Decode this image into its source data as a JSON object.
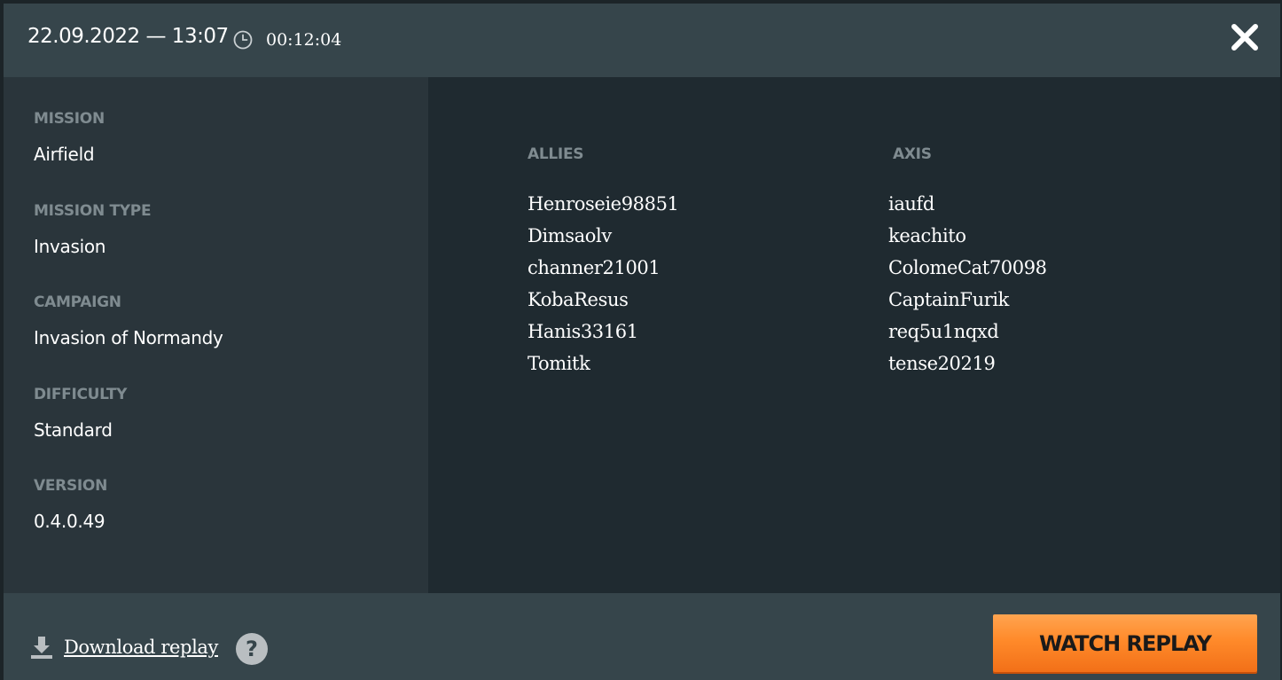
{
  "header": {
    "datetime": "22.09.2022 — 13:07",
    "duration_icon": "clock-icon",
    "duration": "00:12:04",
    "close_icon": "close-icon"
  },
  "info": {
    "mission_label": "MISSION",
    "mission_value": "Airfield",
    "mission_type_label": "MISSION TYPE",
    "mission_type_value": "Invasion",
    "campaign_label": "CAMPAIGN",
    "campaign_value": "Invasion of Normandy",
    "difficulty_label": "DIFFICULTY",
    "difficulty_value": "Standard",
    "version_label": "VERSION",
    "version_value": "0.4.0.49"
  },
  "teams": {
    "allies": {
      "title": "ALLIES",
      "players": [
        "Henroseie98851",
        "Dimsaolv",
        "channer21001",
        "KobaResus",
        "Hanis33161",
        "Tomitk"
      ]
    },
    "axis": {
      "title": "AXIS",
      "players": [
        "iaufd",
        "keachito",
        "ColomeCat70098",
        "CaptainFurik",
        "req5u1nqxd",
        "tense20219"
      ]
    }
  },
  "footer": {
    "download_icon": "download-icon",
    "download_label": "Download replay",
    "help_icon": "help-icon",
    "help_glyph": "?",
    "watch_label": "WATCH REPLAY"
  },
  "colors": {
    "header_bg": "#36454b",
    "left_panel_bg": "#2a353b",
    "right_panel_bg": "#1f2a30",
    "label_gray": "#7f8b90",
    "accent_orange": "#ff8a2a"
  }
}
